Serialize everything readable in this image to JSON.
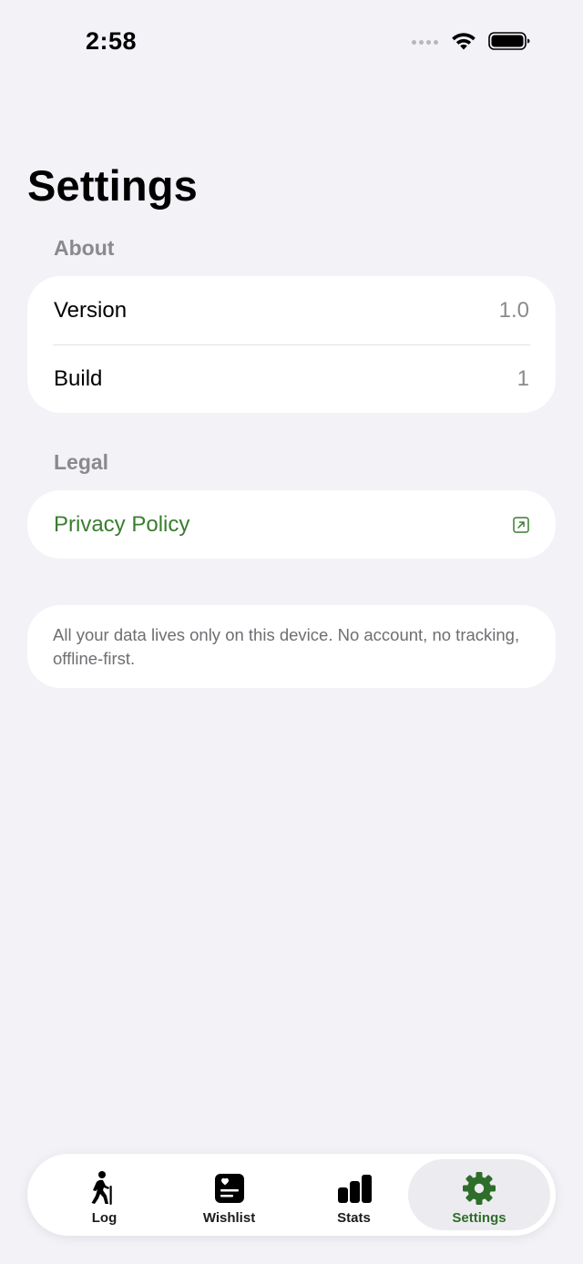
{
  "status_bar": {
    "time": "2:58"
  },
  "page": {
    "title": "Settings"
  },
  "about": {
    "header": "About",
    "rows": [
      {
        "label": "Version",
        "value": "1.0"
      },
      {
        "label": "Build",
        "value": "1"
      }
    ]
  },
  "legal": {
    "header": "Legal",
    "privacy_label": "Privacy Policy",
    "privacy_icon": "external-link-icon"
  },
  "note": {
    "text": "All your data lives only on this device. No account, no tracking, offline-first."
  },
  "tabbar": {
    "items": [
      {
        "label": "Log",
        "icon": "hiker-icon"
      },
      {
        "label": "Wishlist",
        "icon": "wishlist-icon"
      },
      {
        "label": "Stats",
        "icon": "bar-chart-icon"
      },
      {
        "label": "Settings",
        "icon": "gear-icon",
        "active": true
      }
    ]
  },
  "colors": {
    "accent": "#3a7d2f",
    "background": "#f2f2f7",
    "secondary_text": "#8a8a8e"
  }
}
